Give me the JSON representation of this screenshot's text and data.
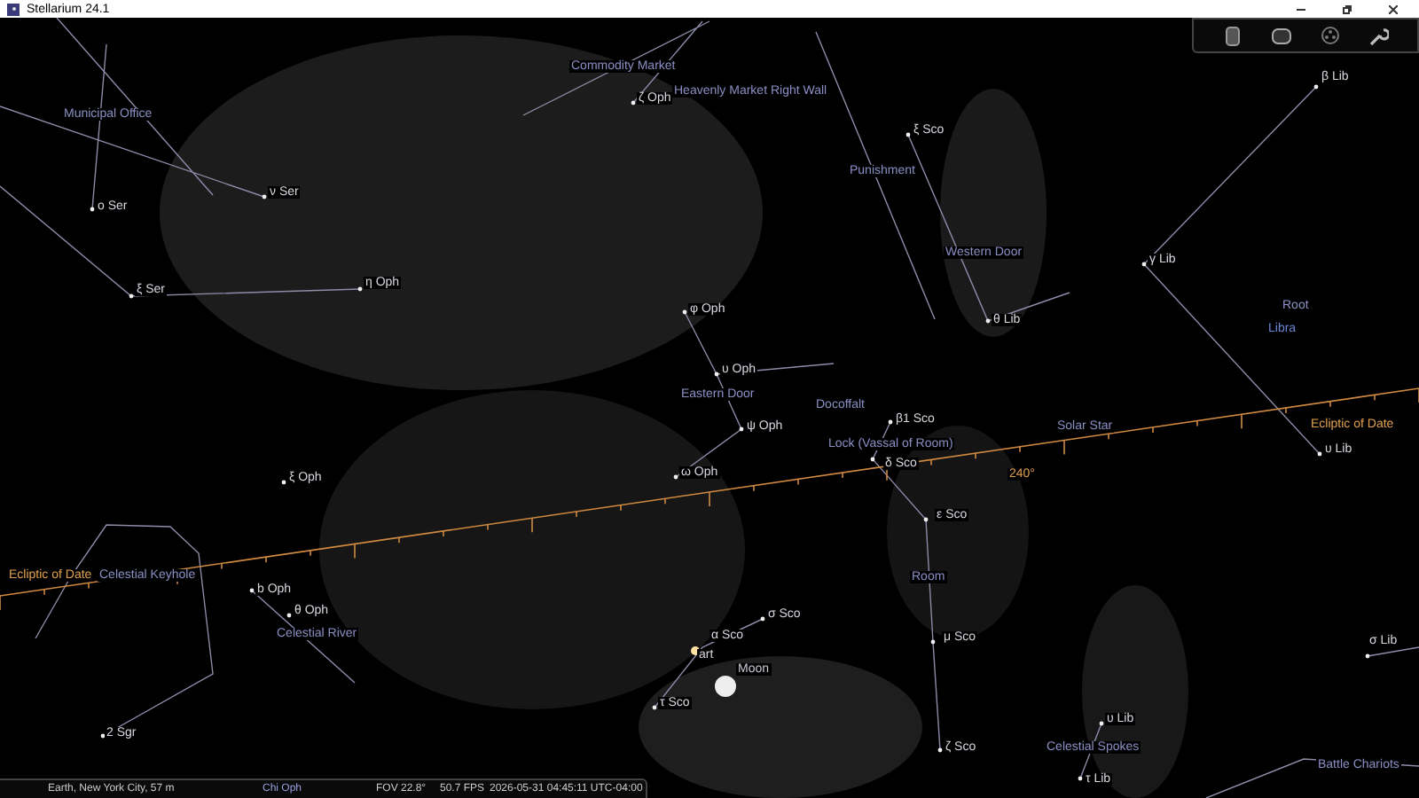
{
  "window": {
    "title": "Stellarium 24.1"
  },
  "toolbar": {
    "buttons": [
      {
        "kind": "cylinder"
      },
      {
        "kind": "screen"
      },
      {
        "kind": "reel"
      },
      {
        "kind": "wrench"
      }
    ]
  },
  "sky": {
    "labels": [
      {
        "kind": "asterism",
        "text": "Commodity Market"
      },
      {
        "kind": "star",
        "text": "β Lib"
      },
      {
        "kind": "star",
        "text": "ζ Oph"
      },
      {
        "kind": "asterism",
        "text": "Heavenly Market Right Wall"
      },
      {
        "kind": "asterism",
        "text": "Municipal Office"
      },
      {
        "kind": "star",
        "text": "ξ Sco"
      },
      {
        "kind": "asterism",
        "text": "Punishment"
      },
      {
        "kind": "star",
        "text": "ν Ser"
      },
      {
        "kind": "star",
        "text": "ο Ser"
      },
      {
        "kind": "asterism",
        "text": "Western Door"
      },
      {
        "kind": "star",
        "text": "γ Lib"
      },
      {
        "kind": "star",
        "text": "ξ Ser"
      },
      {
        "kind": "star",
        "text": "η Oph"
      },
      {
        "kind": "star",
        "text": "φ Oph"
      },
      {
        "kind": "asterism",
        "text": "Root"
      },
      {
        "kind": "star",
        "text": "θ Lib"
      },
      {
        "kind": "constellation",
        "text": "Libra"
      },
      {
        "kind": "star",
        "text": "υ Oph"
      },
      {
        "kind": "asterism",
        "text": "Eastern Door"
      },
      {
        "kind": "asterism",
        "text": "Docoffalt"
      },
      {
        "kind": "star",
        "text": "ψ Oph"
      },
      {
        "kind": "star",
        "text": "β1 Sco"
      },
      {
        "kind": "asterism",
        "text": "Solar Star"
      },
      {
        "kind": "ecliptic",
        "text": "Ecliptic of Date"
      },
      {
        "kind": "asterism",
        "text": "Lock (Vassal of Room)"
      },
      {
        "kind": "star",
        "text": "υ Lib"
      },
      {
        "kind": "star",
        "text": "ξ Oph"
      },
      {
        "kind": "star",
        "text": "ω Oph"
      },
      {
        "kind": "star",
        "text": "δ Sco"
      },
      {
        "kind": "ecliptic",
        "text": "240°"
      },
      {
        "kind": "star",
        "text": "ε Sco"
      },
      {
        "kind": "ecliptic",
        "text": "Ecliptic of Date"
      },
      {
        "kind": "asterism",
        "text": "Celestial Keyhole"
      },
      {
        "kind": "asterism",
        "text": "Room"
      },
      {
        "kind": "star",
        "text": "b Oph"
      },
      {
        "kind": "star",
        "text": "θ Oph"
      },
      {
        "kind": "star",
        "text": "σ Sco"
      },
      {
        "kind": "asterism",
        "text": "Celestial River"
      },
      {
        "kind": "star",
        "text": "α Sco"
      },
      {
        "kind": "star",
        "text": "μ Sco"
      },
      {
        "kind": "star",
        "text": "σ Lib"
      },
      {
        "kind": "star",
        "text": "art"
      },
      {
        "kind": "planet",
        "text": "Moon"
      },
      {
        "kind": "star",
        "text": "τ Sco"
      },
      {
        "kind": "star",
        "text": "υ Lib"
      },
      {
        "kind": "star",
        "text": "2 Sgr"
      },
      {
        "kind": "star",
        "text": "ζ Sco"
      },
      {
        "kind": "asterism",
        "text": "Celestial Spokes"
      },
      {
        "kind": "asterism",
        "text": "Battle Chariots"
      },
      {
        "kind": "star",
        "text": "τ Lib"
      }
    ]
  },
  "status_bar": {
    "location": "Earth, New York City, 57 m",
    "object": "Chi Oph",
    "fov": "FOV 22.8°",
    "fps": "50.7 FPS",
    "datetime": "2026-05-31 04:45:11 UTC-04:00"
  }
}
